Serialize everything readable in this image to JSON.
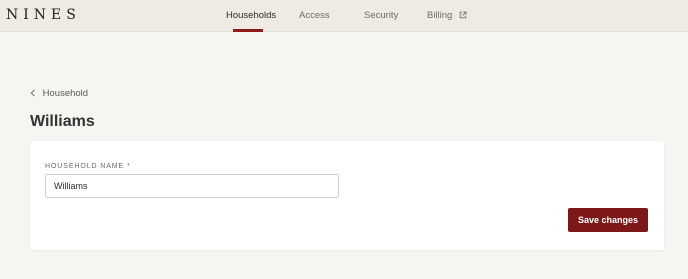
{
  "brand": {
    "logo_text": "NINES"
  },
  "nav": {
    "items": [
      {
        "label": "Households",
        "active": true
      },
      {
        "label": "Access",
        "active": false
      },
      {
        "label": "Security",
        "active": false
      },
      {
        "label": "Billing",
        "active": false,
        "icon": "external-link-icon"
      }
    ]
  },
  "breadcrumb": {
    "back_label": "Household",
    "icon": "chevron-left-icon"
  },
  "page": {
    "title": "Williams"
  },
  "form": {
    "household_name_label": "HOUSEHOLD NAME *",
    "household_name_value": "Williams",
    "save_label": "Save changes"
  },
  "colors": {
    "accent": "#7d1818",
    "topbar": "#efebe3",
    "background": "#f7f5f1",
    "card": "#ffffff"
  }
}
